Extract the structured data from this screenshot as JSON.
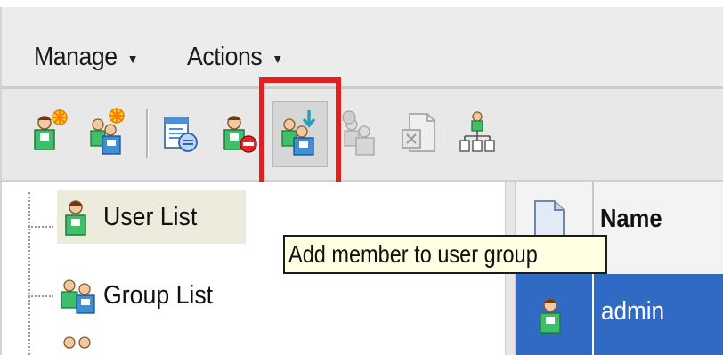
{
  "menubar": {
    "items": [
      {
        "label": "Manage"
      },
      {
        "label": "Actions"
      }
    ],
    "caret": "▼"
  },
  "toolbar": {
    "buttons": [
      {
        "name": "add-user",
        "icon": "user-add-icon",
        "enabled": true
      },
      {
        "name": "add-group",
        "icon": "group-add-icon",
        "enabled": true
      },
      {
        "name": "properties",
        "icon": "properties-icon",
        "enabled": true
      },
      {
        "name": "delete-user",
        "icon": "user-delete-icon",
        "enabled": true
      },
      {
        "name": "add-member",
        "icon": "add-member-icon",
        "enabled": true,
        "highlighted": true
      },
      {
        "name": "remove-member",
        "icon": "remove-member-icon",
        "enabled": false
      },
      {
        "name": "export",
        "icon": "export-document-icon",
        "enabled": false
      },
      {
        "name": "hierarchy",
        "icon": "hierarchy-icon",
        "enabled": true
      }
    ],
    "highlight_color": "#e41f1f"
  },
  "tree": {
    "items": [
      {
        "label": "User List",
        "icon": "user-icon",
        "selected": true
      },
      {
        "label": "Group List",
        "icon": "group-icon",
        "selected": false
      },
      {
        "label": "",
        "icon": "group-icon",
        "selected": false
      }
    ]
  },
  "grid": {
    "columns": [
      {
        "label": "",
        "icon": "document-icon"
      },
      {
        "label": "Name"
      }
    ],
    "rows": [
      {
        "icon": "user-icon",
        "name": "admin",
        "selected": true
      }
    ],
    "selection_color": "#316ac5"
  },
  "tooltip": {
    "text": "Add member to user group"
  }
}
